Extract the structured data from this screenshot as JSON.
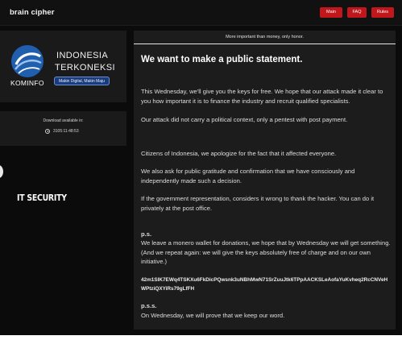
{
  "header": {
    "brand": "brain cipher",
    "nav": {
      "main": "Main",
      "faq": "FAQ",
      "rules": "Rules"
    }
  },
  "victim": {
    "logo_text": "KOMINFO",
    "title_line1": "INDONESIA",
    "title_line2": "TERKONEKSI",
    "tagline": "Makin Digital, Makin Maju",
    "download_label": "Download available in:",
    "download_time": "3105:11:48:53"
  },
  "overlay": {
    "watermark": "IT SECURITY"
  },
  "statement": {
    "header": "More important than money, only honor.",
    "title": "We want to make a public statement.",
    "p1": "This Wednesday, we'll give you the keys for free. We hope that our attack made it clear to you how important it is to finance the industry and recruit qualified specialists.",
    "p2": "Our attack did not carry a political context, only a pentest with post payment.",
    "p3": "Citizens of Indonesia, we apologize for the fact that it affected everyone.",
    "p4": "We also ask for public gratitude and confirmation that we have consciously and independently made such a decision.",
    "p5": "If the government representation, considers it wrong to thank the hacker. You can do it privately at the post office.",
    "ps_label": "p.s.",
    "ps_text": "We leave a monero wallet for donations, we hope that by Wednesday we will get something. (And we repeat again: we will give the keys absolutely free of charge and on our own initiative.)",
    "wallet": "42m1SIK7EWq4TSKXu6FkDicPQwsnk3uNBhMwN71SrZuuJtk6TPpAACKSLeAofaYuKvheq2RcCNVeHWPtziQXYiRs79gLfFH",
    "pss_label": "p.s.s.",
    "pss_text": "On Wednesday, we will prove that we keep our word."
  },
  "colors": {
    "accent": "#c0171d",
    "background": "#0b0b0b",
    "panel": "#1c1c1c",
    "logo_blue": "#1f5fae"
  },
  "icons": {
    "clock": "clock-icon",
    "logo": "kominfo-logo-icon"
  }
}
